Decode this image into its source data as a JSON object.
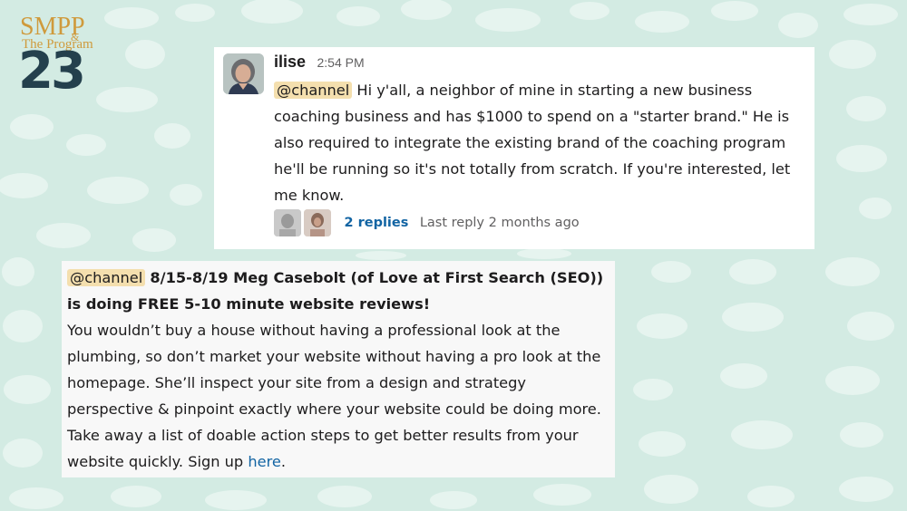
{
  "logo": {
    "brand": "SMPP",
    "ampersand": "&",
    "subtitle": "The Program",
    "year": "23"
  },
  "message1": {
    "user": "ilise",
    "time": "2:54 PM",
    "mention": "@channel",
    "text": "Hi y'all, a neighbor of mine in starting a new business coaching business and has $1000 to spend on a \"starter brand.\" He is also required to integrate the existing brand of the coaching program he'll be running so it's not totally from scratch. If you're interested, let me know.",
    "thread": {
      "replies": "2 replies",
      "last_reply": "Last reply 2 months ago"
    }
  },
  "message2": {
    "mention": "@channel",
    "title": "8/15-8/19 Meg Casebolt (of Love at First Search (SEO)) is doing FREE 5-10 minute website reviews!",
    "body": "You wouldn’t buy a house without having a professional look at the plumbing, so don’t market your website without having a pro look at the homepage. She’ll inspect your site from a design and strategy perspective & pinpoint exactly where your website could be doing more. Take away a list of doable action steps to get better results from your website quickly. Sign up",
    "link_text": "here",
    "after_link": "."
  },
  "colors": {
    "background": "#d3ebe3",
    "blob": "#e6f4ef",
    "mention_bg": "#f4dfae",
    "link": "#1264a3",
    "logo_gold": "#cf9a3c",
    "logo_navy": "#24404d"
  }
}
